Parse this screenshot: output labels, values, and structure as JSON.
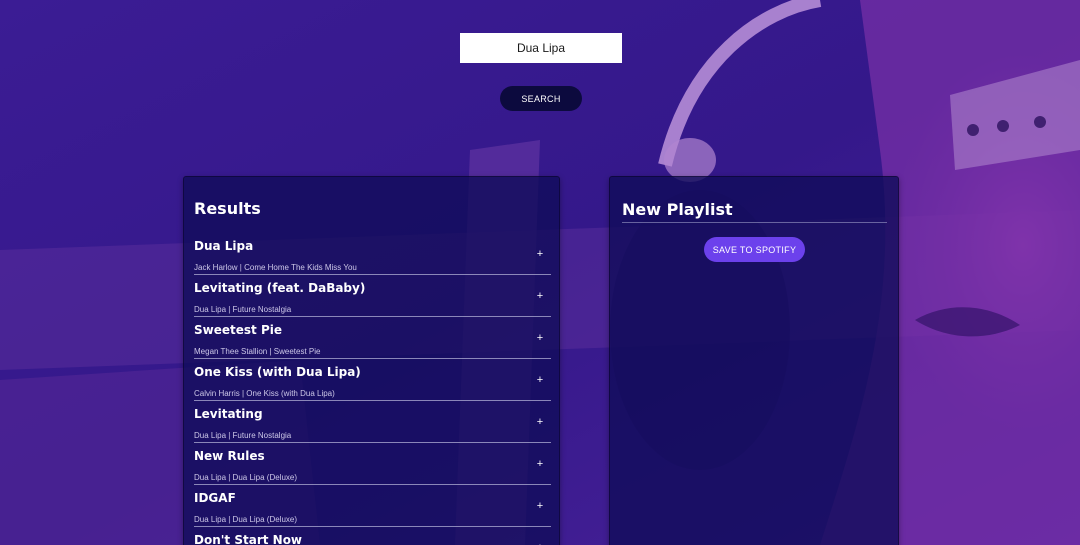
{
  "colors": {
    "background": "#3a1a92",
    "panel": "#100c58",
    "search_button": "#0c0a3e",
    "save_button": "#6c41ec"
  },
  "search": {
    "value": "Dua Lipa",
    "button_label": "SEARCH"
  },
  "results": {
    "title": "Results",
    "tracks": [
      {
        "name": "Dua Lipa",
        "info": "Jack Harlow | Come Home The Kids Miss You",
        "action": "+"
      },
      {
        "name": "Levitating (feat. DaBaby)",
        "info": "Dua Lipa | Future Nostalgia",
        "action": "+"
      },
      {
        "name": "Sweetest Pie",
        "info": "Megan Thee Stallion | Sweetest Pie",
        "action": "+"
      },
      {
        "name": "One Kiss (with Dua Lipa)",
        "info": "Calvin Harris | One Kiss (with Dua Lipa)",
        "action": "+"
      },
      {
        "name": "Levitating",
        "info": "Dua Lipa | Future Nostalgia",
        "action": "+"
      },
      {
        "name": "New Rules",
        "info": "Dua Lipa | Dua Lipa (Deluxe)",
        "action": "+"
      },
      {
        "name": "IDGAF",
        "info": "Dua Lipa | Dua Lipa (Deluxe)",
        "action": "+"
      },
      {
        "name": "Don't Start Now",
        "info": "",
        "action": "+"
      }
    ]
  },
  "playlist": {
    "name": "New Playlist",
    "save_label": "SAVE TO SPOTIFY"
  }
}
